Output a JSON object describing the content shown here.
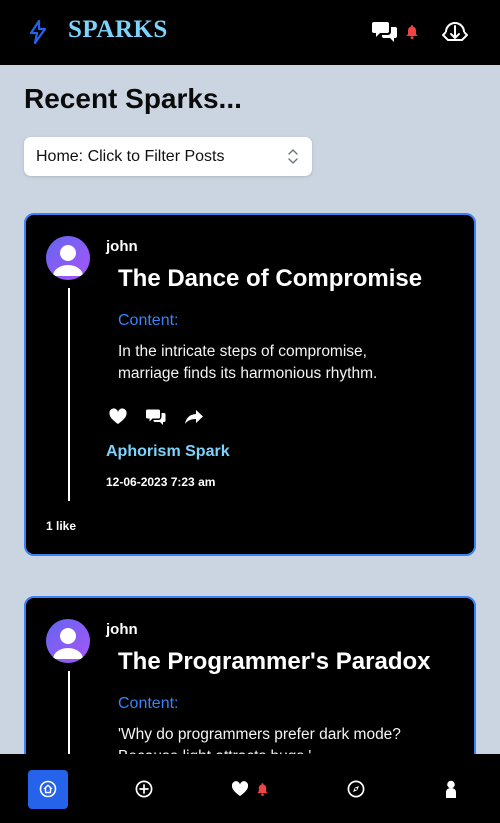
{
  "app": {
    "brand": "SPARKS",
    "brand_color": "#7dd3fc",
    "accent_color": "#3b82f6",
    "header_icons": [
      "bolt-icon",
      "chat-bubbles-icon",
      "notification-bell-icon",
      "logout-icon"
    ]
  },
  "page": {
    "title": "Recent Sparks..."
  },
  "filter": {
    "selected": "Home: Click to Filter Posts"
  },
  "posts": [
    {
      "username": "john",
      "title": "The Dance of Compromise",
      "content_label": "Content:",
      "content": "In the intricate steps of compromise, marriage finds its harmonious rhythm.",
      "type": "Aphorism Spark",
      "date": "12-06-2023 7:23 am",
      "likes": "1 like"
    },
    {
      "username": "john",
      "title": "The Programmer's Paradox",
      "content_label": "Content:",
      "content": "'Why do programmers prefer dark mode? Because light attracts bugs.'"
    }
  ],
  "bottom_nav": {
    "active": "home",
    "items": [
      "home-icon",
      "add-post-icon",
      "favorites-heart-icon",
      "explore-compass-icon",
      "profile-icon"
    ]
  }
}
